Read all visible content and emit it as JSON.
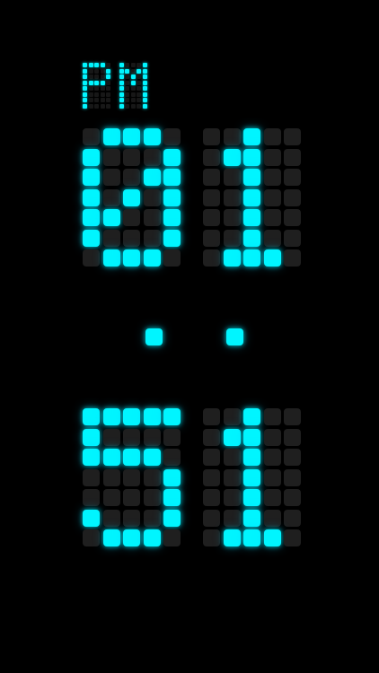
{
  "clock": {
    "period": "PM",
    "hours": "01",
    "minutes": "51",
    "colors": {
      "lit": "#00f5ff",
      "unlit": "#1f1f1f",
      "background": "#000000"
    }
  }
}
